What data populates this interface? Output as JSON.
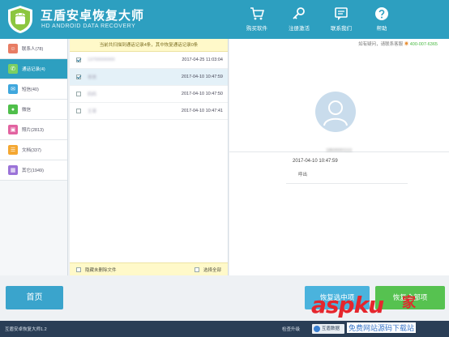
{
  "header": {
    "title": "互盾安卓恢复大师",
    "subtitle": "HD ANDROID DATA RECOVERY",
    "nav": [
      {
        "label": "购买软件",
        "icon": "cart-icon"
      },
      {
        "label": "注册激活",
        "icon": "key-icon"
      },
      {
        "label": "联系我们",
        "icon": "chat-icon"
      },
      {
        "label": "帮助",
        "icon": "question-icon"
      }
    ]
  },
  "sidebar": {
    "items": [
      {
        "label": "联系人(78)",
        "icon": "contacts-icon",
        "color": "#e87d64"
      },
      {
        "label": "通话记录(4)",
        "icon": "phone-icon",
        "color": "#7bcf62"
      },
      {
        "label": "短信(40)",
        "icon": "sms-icon",
        "color": "#3fa7dd"
      },
      {
        "label": "微信",
        "icon": "wechat-icon",
        "color": "#4fbf4a"
      },
      {
        "label": "照片(2813)",
        "icon": "photo-icon",
        "color": "#e263a0"
      },
      {
        "label": "文档(337)",
        "icon": "doc-icon",
        "color": "#f4a731"
      },
      {
        "label": "其它(1949)",
        "icon": "other-icon",
        "color": "#9b73d8"
      }
    ]
  },
  "list": {
    "notice": "当前共扫描到通话记录4条，其中恢复通话记录0条",
    "rows": [
      {
        "name": "13700000000",
        "time": "2017-04-25 11:03:04",
        "checked": true
      },
      {
        "name": "爸爸",
        "time": "2017-04-10 10:47:59",
        "checked": true
      },
      {
        "name": "妈妈",
        "time": "2017-04-10 10:47:50",
        "checked": false
      },
      {
        "name": "王哥",
        "time": "2017-04-10 10:47:41",
        "checked": false
      }
    ],
    "hide_deleted_label": "隐藏未删除文件",
    "select_all_label": "选择全部"
  },
  "detail": {
    "helpline_label": "如有疑问，请联系客服",
    "helpline_number": "400-007-6365",
    "contact_number": "18600001111",
    "call_time": "2017-04-10 10:47:59",
    "call_type": "呼出"
  },
  "actions": {
    "home": "首页",
    "recover": "恢复选中项",
    "recover_all": "恢复全部项"
  },
  "status": {
    "version": "互盾安卓恢复大师1.2",
    "update_check": "检查升级",
    "tray_label": "互盾数据"
  },
  "watermark": {
    "logo_a": "asp",
    "logo_b": "ku",
    "logo_cn": "家",
    "sub": "免费网站源码下载站"
  }
}
